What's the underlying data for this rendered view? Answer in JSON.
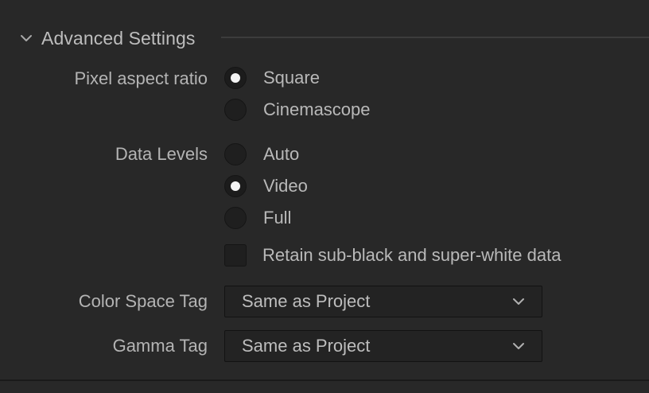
{
  "section": {
    "title": "Advanced Settings",
    "expanded_icon": "chevron-down-icon"
  },
  "pixel_aspect_ratio": {
    "label": "Pixel aspect ratio",
    "options": [
      {
        "label": "Square",
        "checked": true
      },
      {
        "label": "Cinemascope",
        "checked": false
      }
    ]
  },
  "data_levels": {
    "label": "Data Levels",
    "options": [
      {
        "label": "Auto",
        "checked": false
      },
      {
        "label": "Video",
        "checked": true
      },
      {
        "label": "Full",
        "checked": false
      }
    ],
    "retain_checkbox": {
      "label": "Retain sub-black and super-white data",
      "checked": false
    }
  },
  "color_space_tag": {
    "label": "Color Space Tag",
    "value": "Same as Project"
  },
  "gamma_tag": {
    "label": "Gamma Tag",
    "value": "Same as Project"
  },
  "colors": {
    "background": "#282828",
    "text": "#b9b9b9",
    "control_fill": "#1f1f1f",
    "radio_dot": "#f4f4f4"
  }
}
